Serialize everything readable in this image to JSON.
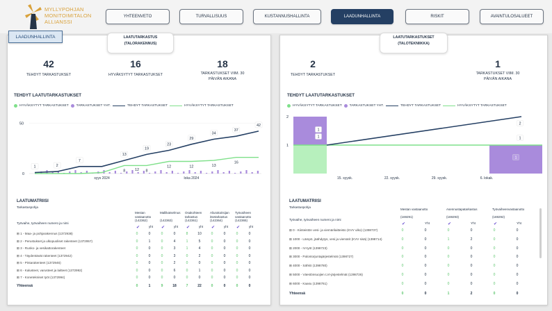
{
  "brand": {
    "line1": "MYLLYPOHJAN",
    "line2": "MONITOIMITALON",
    "line3": "ALLIANSSI"
  },
  "nav": [
    "YHTEENVETO",
    "TURVALLISUUS",
    "KUSTANNUSHALLINTA",
    "LAADUNHALLINTA",
    "RISKIT",
    "AVAINTULOSALUEET"
  ],
  "active_nav": "LAADUNHALLINTA",
  "page_tag": "LAADUNHALLINTA",
  "left": {
    "tab_line1": "LAATUTARKASTUS",
    "tab_line2": "(TALORAKENNUS)",
    "kpis": [
      {
        "value": "42",
        "label": "TEHDYT TARKASTUKSET"
      },
      {
        "value": "16",
        "label": "HYVÄKSYTYT TARKASTUKSET"
      },
      {
        "value": "18",
        "label": "TARKASTUKSET VIIM. 30 PÄIVÄN AIKANA"
      }
    ],
    "section": "TEHDYT LAATUTARKASTUKSET",
    "legend": [
      "HYVÄKSYTYT TARKASTUKSET",
      "TARKASTUKSET YHT.",
      "TEHDYT TARKASTUKSET",
      "HYVÄKSYTYT TARKASTUKSET"
    ],
    "matrix_title": "LAATUMATRIISI",
    "matrix_sub": "Tarkastuspohja",
    "row_header": "Työvaihe, työvaiheen numero ja nimi",
    "col_groups": [
      {
        "name": "Mestan vastaanotto",
        "id": "(142362)"
      },
      {
        "name": "Mallikatselmus",
        "id": "(142363)"
      },
      {
        "name": "Osakohteen tarkastus",
        "id": "(142361)"
      },
      {
        "name": "Aliurakoitsijan itsetarkastus",
        "id": "(142364)"
      },
      {
        "name": "Työvaiheen vastaanotto",
        "id": "(142365)"
      }
    ],
    "yht_label": "yht",
    "rows": [
      {
        "name": "1 - Maa- ja pohjarakennus (1372938)",
        "v": [
          "0",
          "0",
          "0",
          "0",
          "8",
          "10",
          "0",
          "0",
          "0",
          "0"
        ]
      },
      {
        "name": "2 - Perustukset ja ulkopuoliset rakenteet (1372957)",
        "v": [
          "0",
          "1",
          "0",
          "4",
          "1",
          "5",
          "0",
          "0",
          "0",
          "0"
        ]
      },
      {
        "name": "3 - Runko- ja vesikattorakenteet",
        "v": [
          "0",
          "0",
          "0",
          "3",
          "1",
          "4",
          "0",
          "0",
          "0",
          "0"
        ]
      },
      {
        "name": "4 - Täydentävät rakenteet (1372942)",
        "v": [
          "0",
          "0",
          "0",
          "3",
          "0",
          "2",
          "0",
          "0",
          "0",
          "0"
        ]
      },
      {
        "name": "5 - Pintarakenteet (1372946)",
        "v": [
          "0",
          "0",
          "0",
          "2",
          "0",
          "0",
          "0",
          "0",
          "0",
          "0"
        ]
      },
      {
        "name": "6 - Kalusteet, varusteet ja laitteet (1372992)",
        "v": [
          "0",
          "0",
          "0",
          "6",
          "0",
          "1",
          "0",
          "0",
          "0",
          "0"
        ]
      },
      {
        "name": "7 - Konetekniset työt (1372994)",
        "v": [
          "0",
          "0",
          "0",
          "0",
          "0",
          "0",
          "0",
          "0",
          "0",
          "0"
        ]
      }
    ],
    "total_label": "Yhteensä",
    "totals": [
      "0",
      "1",
      "9",
      "18",
      "7",
      "22",
      "0",
      "0",
      "0",
      "0"
    ]
  },
  "right": {
    "tab_line1": "LAATUTARKASTUKSET",
    "tab_line2": "(TALOTEKNIIKKA)",
    "kpis": [
      {
        "value": "2",
        "label": "TEHDYT TARKASTUKSET"
      },
      {
        "value": "1",
        "label": "TARKASTUKSET VIIM. 30 PÄIVÄN AIKANA"
      }
    ],
    "section": "TEHDYT LAATUTARKASTUKSET",
    "legend": [
      "HYVÄKSYTYT TARKASTUKSET",
      "TARKASTUKSET YHT.",
      "TEHDYT TARKASTUKSET",
      "HYVÄKSYTYT TARKASTUKSET"
    ],
    "matrix_title": "LAATUMATRIISI",
    "matrix_sub": "Tarkastuspohja",
    "row_header": "Työvaihe, työvaiheen numero ja nimi",
    "col_groups": [
      {
        "name": "Mestan vastaanotto",
        "id": "(169291)"
      },
      {
        "name": "Asennustapatarkastus",
        "id": "(169293)"
      },
      {
        "name": "Työvaiheenvastaanotto",
        "id": "(169292)"
      }
    ],
    "yht_label": "Yht",
    "rows": [
      {
        "name": "0 - Kiinteistön vesi- ja viemärilaitteisto (KVV ulko) (1398737)",
        "v": [
          "0",
          "0",
          "0",
          "0",
          "0",
          "0"
        ]
      },
      {
        "name": "1000 - Lämpö, jäähdytys, vesi ja viemärit (KVV sisä) (1398714)",
        "v": [
          "0",
          "0",
          "1",
          "2",
          "0",
          "0"
        ]
      },
      {
        "name": "2000 - IV-työt (1398723)",
        "v": [
          "0",
          "0",
          "0",
          "0",
          "0",
          "0"
        ]
      },
      {
        "name": "3000 - Palontorjuntajärjestelmät (1398727)",
        "v": [
          "0",
          "0",
          "0",
          "0",
          "0",
          "0"
        ]
      },
      {
        "name": "4000 - Sähkö (1398780)",
        "v": [
          "0",
          "0",
          "0",
          "0",
          "0",
          "0"
        ]
      },
      {
        "name": "5000 - Väestönsuojien LVI-järjestelmät (1398726)",
        "v": [
          "0",
          "0",
          "0",
          "0",
          "0",
          "0"
        ]
      },
      {
        "name": "6000 - Kaasu (1398761)",
        "v": [
          "0",
          "0",
          "0",
          "0",
          "0",
          "0"
        ]
      }
    ],
    "total_label": "Yhteensä",
    "totals": [
      "0",
      "0",
      "1",
      "2",
      "0",
      "0"
    ]
  },
  "chart_data": [
    {
      "type": "line",
      "x_ticks": [
        "syys 2024",
        "loka 2024"
      ],
      "y_ticks": [
        "0",
        "50"
      ],
      "ylim": [
        0,
        55
      ],
      "series": [
        {
          "name": "TEHDYT TARKASTUKSET",
          "values": [
            1,
            2,
            7,
            7,
            13,
            19,
            23,
            29,
            34,
            37,
            42
          ]
        },
        {
          "name": "HYVÄKSYTYT TARKASTUKSET",
          "values": [
            0,
            0,
            0,
            1,
            8,
            8,
            12,
            12,
            13,
            16,
            16
          ]
        }
      ],
      "data_labels": [
        "1",
        "2",
        "7",
        "7",
        "13",
        "19",
        "23",
        "29",
        "34",
        "37",
        "42",
        "8",
        "12",
        "12",
        "13",
        "16",
        "16",
        "12"
      ]
    },
    {
      "type": "line",
      "x_ticks": [
        "15. syysk.",
        "22. syysk.",
        "29. syysk.",
        "6. lokak."
      ],
      "y_ticks": [
        "1",
        "2"
      ],
      "ylim": [
        0,
        2
      ],
      "series": [
        {
          "name": "TEHDYT TARKASTUKSET",
          "values": [
            1,
            2
          ]
        },
        {
          "name": "HYVÄKSYTYT TARKASTUKSET",
          "values": [
            1,
            1
          ]
        },
        {
          "name": "TARKASTUKSET YHT.",
          "values": [
            1,
            1
          ]
        }
      ],
      "data_labels": [
        "1",
        "1",
        "2",
        "1",
        "1"
      ]
    }
  ],
  "colors": {
    "navy": "#243f63",
    "green": "#7fe08a",
    "purple": "#a98bdc",
    "gold": "#d9a23c"
  }
}
